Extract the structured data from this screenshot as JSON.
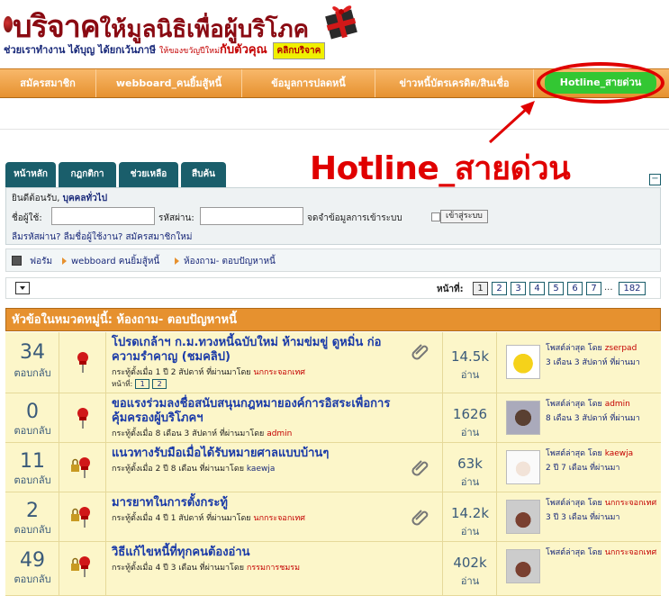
{
  "banner": {
    "title_big": "บริจาค",
    "title_rest": "ให้มูลนิธิเพื่อผู้บริโภค",
    "sub_main": "ช่วยเราทำงาน ได้บุญ ได้ยกเว้นภาษี",
    "sub_small": "ให้ของขวัญปีใหม่",
    "sub_big": "กับตัวคุณ",
    "click_label": "คลิกบริจาค"
  },
  "topnav": {
    "items": [
      {
        "label": "สมัครสมาชิก"
      },
      {
        "label": "webboard_คนยิ้มสู้หนี้"
      },
      {
        "label": "ข้อมูลการปลดหนี้"
      },
      {
        "label": "ข่าวหนี้บัตรเครดิต/สินเชื่อ"
      },
      {
        "label": "Hotline_สายด่วน"
      }
    ]
  },
  "annotation": {
    "text": "Hotline_สายด่วน",
    "color": "#e00000"
  },
  "tabs": [
    {
      "label": "หน้าหลัก"
    },
    {
      "label": "กฎกติกา"
    },
    {
      "label": "ช่วยเหลือ"
    },
    {
      "label": "สืบค้น"
    }
  ],
  "login": {
    "welcome_prefix": "ยินดีต้อนรับ,",
    "welcome_user": "บุคคลทั่วไป",
    "username_label": "ชื่อผู้ใช้:",
    "password_label": "รหัสผ่าน:",
    "remember_label": "จดจำข้อมูลการเข้าระบบ",
    "login_button": "เข้าสู่ระบบ",
    "links": "ลืมรหัสผ่าน? ลืมชื่อผู้ใช้งาน? สมัครสมาชิกใหม่"
  },
  "breadcrumbs": [
    "ฟอรัม",
    "webboard คนยิ้มสู้หนี้",
    "ห้องถาม- ตอบปัญหาหนี้"
  ],
  "pager": {
    "label": "หน้าที่:",
    "pages": [
      "1",
      "2",
      "3",
      "4",
      "5",
      "6",
      "7"
    ],
    "ellipsis": "...",
    "last": "182",
    "current": "1"
  },
  "list": {
    "heading": "หัวข้อในหมวดหมู่นี้: ห้องถาม- ตอบปัญหาหนี้",
    "replies_label": "ตอบกลับ",
    "views_label": "อ่าน",
    "last_post_prefix": "โพสต์ล่าสุด โดย",
    "topics": [
      {
        "replies": "34",
        "title": "โปรดเกล้าฯ ก.ม.ทวงหนี้ฉบับใหม่ ห้ามข่มขู่ ดูหมิ่น ก่อความรำคาญ (ชมคลิป)",
        "meta_prefix": "กระทู้ตั้งเมื่อ 1 ปี 2 สัปดาห์ ที่ผ่านมาโดย",
        "author": "นกกระจอกเทศ",
        "mini_pager_label": "หน้าที่:",
        "mini_pages": [
          "1",
          "2"
        ],
        "views": "14.5k",
        "last_user": "zserpad",
        "last_time": "3 เดือน 3 สัปดาห์ ที่ผ่านมา",
        "has_attachment": true
      },
      {
        "replies": "0",
        "title": "ขอแรงร่วมลงชื่อสนับสนุนกฎหมายองค์การอิสระเพื่อการคุ้มครองผู้บริโภคฯ",
        "meta_prefix": "กระทู้ตั้งเมื่อ 8 เดือน 3 สัปดาห์ ที่ผ่านมาโดย",
        "author": "admin",
        "views": "1626",
        "last_user": "admin",
        "last_time": "8 เดือน 3 สัปดาห์ ที่ผ่านมา",
        "has_attachment": false
      },
      {
        "replies": "11",
        "title": "แนวทางรับมือเมื่อได้รับหมายศาลแบบบ้านๆ",
        "meta_prefix": "กระทู้ตั้งเมื่อ 2 ปี 8 เดือน ที่ผ่านมาโดย",
        "author": "kaewja",
        "views": "63k",
        "last_user": "kaewja",
        "last_time": "2 ปี 7 เดือน ที่ผ่านมา",
        "has_attachment": true
      },
      {
        "replies": "2",
        "title": "มารยาทในการตั้งกระทู้",
        "meta_prefix": "กระทู้ตั้งเมื่อ 4 ปี 1 สัปดาห์ ที่ผ่านมาโดย",
        "author": "นกกระจอกเทศ",
        "views": "14.2k",
        "last_user": "นกกระจอกเทศ",
        "last_time": "3 ปี 3 เดือน ที่ผ่านมา",
        "has_attachment": true
      },
      {
        "replies": "49",
        "title": "วิธีแก้ไขหนี้ที่ทุกคนต้องอ่าน",
        "meta_prefix": "กระทู้ตั้งเมื่อ 4 ปี 3 เดือน ที่ผ่านมาโดย",
        "author": "กรรมการชมรม",
        "views": "402k",
        "last_user": "นกกระจอกเทศ",
        "last_time": "",
        "has_attachment": false
      }
    ]
  },
  "colors": {
    "nav": "#e6912f",
    "hotline": "#33c733",
    "tab": "#1a5e6b",
    "row_bg": "#fcf6c9"
  }
}
